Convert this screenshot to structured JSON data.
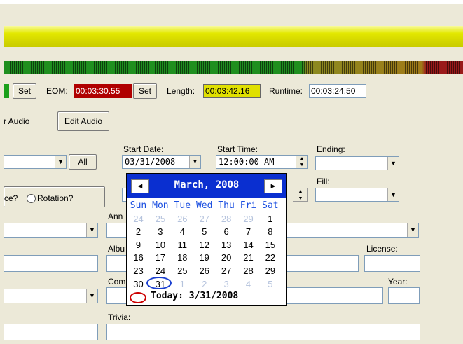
{
  "eom": {
    "set_left": "Set",
    "label": "EOM:",
    "value": "00:03:30.55",
    "set": "Set"
  },
  "length": {
    "label": "Length:",
    "value": "00:03:42.16"
  },
  "runtime": {
    "label": "Runtime:",
    "value": "00:03:24.50"
  },
  "buttons": {
    "audio_partial": "r Audio",
    "edit_audio": "Edit Audio",
    "all": "All"
  },
  "start_date": {
    "label": "Start Date:",
    "value": "03/31/2008"
  },
  "start_time": {
    "label": "Start Time:",
    "value": "12:00:00 AM"
  },
  "ending": {
    "label": "Ending:"
  },
  "fill": {
    "label": "Fill:"
  },
  "rotation": {
    "partial": "ce?",
    "label": "Rotation?"
  },
  "labels": {
    "ann": "Ann",
    "album": "Albu",
    "comp": "Com",
    "license": "License:",
    "year": "Year:",
    "trivia": "Trivia:"
  },
  "calendar": {
    "month": "March, 2008",
    "prev": "◄",
    "next": "►",
    "dows": [
      "Sun",
      "Mon",
      "Tue",
      "Wed",
      "Thu",
      "Fri",
      "Sat"
    ],
    "row1": [
      "24",
      "25",
      "26",
      "27",
      "28",
      "29",
      "1"
    ],
    "row2": [
      "2",
      "3",
      "4",
      "5",
      "6",
      "7",
      "8"
    ],
    "row3": [
      "9",
      "10",
      "11",
      "12",
      "13",
      "14",
      "15"
    ],
    "row4": [
      "16",
      "17",
      "18",
      "19",
      "20",
      "21",
      "22"
    ],
    "row5": [
      "23",
      "24",
      "25",
      "26",
      "27",
      "28",
      "29"
    ],
    "row6": [
      "30",
      "31",
      "1",
      "2",
      "3",
      "4",
      "5"
    ],
    "today": "Today: 3/31/2008"
  },
  "colors": {
    "eom_bg": "#b00000",
    "length_bg": "#e0e000",
    "green_tag": "#1aa01a",
    "header_blue": "#0a2fd0"
  }
}
